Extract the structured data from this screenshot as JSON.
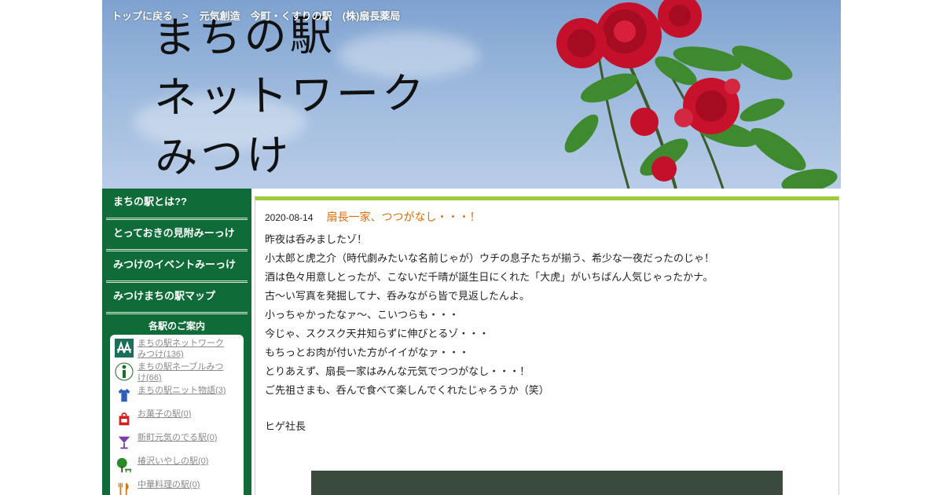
{
  "breadcrumb": {
    "home": "トップに戻る",
    "separator": ">",
    "current": "元気創造　今町・くすりの駅　(株)扇長薬局"
  },
  "site_title": {
    "line1": "まちの駅",
    "line2": "ネットワーク",
    "line3": "みつけ"
  },
  "sidebar": {
    "nav": [
      {
        "label": "まちの駅とは??"
      },
      {
        "label": "とっておきの見附みーっけ"
      },
      {
        "label": "みつけのイベントみーっけ"
      },
      {
        "label": "みつけまちの駅マップ"
      }
    ],
    "stations_heading": "各駅のご案内",
    "stations": [
      {
        "label": "まちの駅ネットワークみつけ(136)",
        "icon": "network-logo-icon"
      },
      {
        "label": "まちの駅ネーブルみつけ(66)",
        "icon": "info-icon"
      },
      {
        "label": "まちの駅ニット物語(3)",
        "icon": "shirt-icon"
      },
      {
        "label": "お菓子の駅(0)",
        "icon": "sweets-bag-icon"
      },
      {
        "label": "新町元気のでる駅(0)",
        "icon": "cocktail-glass-icon"
      },
      {
        "label": "椿沢いやしの駅(0)",
        "icon": "tree-bench-icon"
      },
      {
        "label": "中華料理の駅(0)",
        "icon": "fork-knife-icon"
      }
    ]
  },
  "post": {
    "date": "2020-08-14",
    "title": "扇長一家、つつがなし・・・！",
    "lines": [
      "昨夜は呑みましたゾ！",
      "小太郎と虎之介（時代劇みたいな名前じゃが）ウチの息子たちが揃う、希少な一夜だったのじゃ！",
      "酒は色々用意しとったが、こないだ千晴が誕生日にくれた「大虎」がいちばん人気じゃったかナ。",
      "古～い写真を発掘してナ、呑みながら皆で見返したんよ。",
      "小っちゃかったなァ～、こいつらも・・・",
      "今じゃ、スクスク天井知らずに伸びとるゾ・・・",
      "もちっとお肉が付いた方がイイがなァ・・・",
      "とりあえず、扇長一家はみんな元気でつつがなし・・・！",
      "ご先祖さまも、呑んで食べて楽しんでくれたじゃろうか（笑）",
      "",
      "ヒゲ社長"
    ]
  },
  "colors": {
    "sidebar_green": "#0f6b38",
    "accent_green": "#9ccb3b",
    "title_orange": "#e66b00",
    "link_gray": "#8a8a8a"
  }
}
